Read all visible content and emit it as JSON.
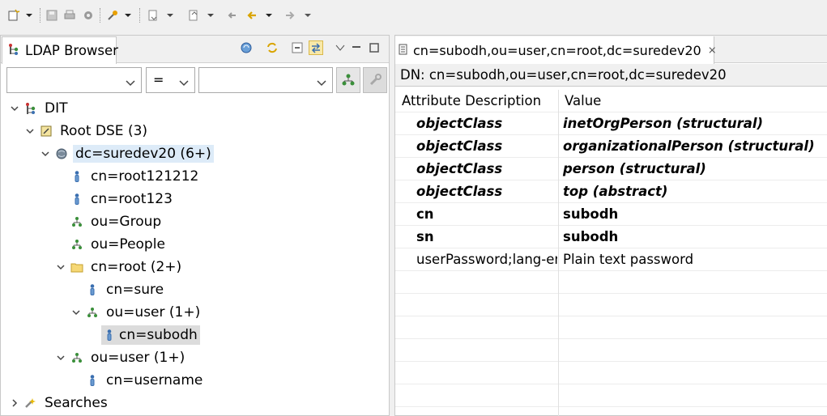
{
  "left_panel": {
    "tab_title": "LDAP Browser",
    "filter": {
      "attribute_value": "",
      "operator_value": "=",
      "value_value": ""
    },
    "tree": [
      {
        "label": "DIT"
      },
      {
        "label": "Root DSE (3)"
      },
      {
        "label": "dc=suredev20 (6+)"
      },
      {
        "label": "cn=root121212"
      },
      {
        "label": "cn=root123"
      },
      {
        "label": "ou=Group"
      },
      {
        "label": "ou=People"
      },
      {
        "label": "cn=root (2+)"
      },
      {
        "label": "cn=sure"
      },
      {
        "label": "ou=user (1+)"
      },
      {
        "label": "cn=subodh"
      },
      {
        "label": "ou=user (1+)"
      },
      {
        "label": "cn=username"
      },
      {
        "label": "Searches"
      }
    ]
  },
  "editor": {
    "tab_title": "cn=subodh,ou=user,cn=root,dc=suredev20",
    "close_glyph": "⨯",
    "dn_text": "DN: cn=subodh,ou=user,cn=root,dc=suredev20",
    "columns": [
      "Attribute Description",
      "Value"
    ],
    "rows": [
      {
        "attr": "objectClass",
        "value": "inetOrgPerson (structural)"
      },
      {
        "attr": "objectClass",
        "value": "organizationalPerson (structural)"
      },
      {
        "attr": "objectClass",
        "value": "person (structural)"
      },
      {
        "attr": "objectClass",
        "value": "top (abstract)"
      },
      {
        "attr": "cn",
        "value": "subodh"
      },
      {
        "attr": "sn",
        "value": "subodh"
      },
      {
        "attr": "userPassword;lang-en-",
        "value": "Plain text password"
      }
    ]
  },
  "icons": {
    "toolbar": [
      "new-icon",
      "save-icon",
      "print-icon",
      "settings-icon",
      "pin-icon",
      "next-annotation-icon",
      "prev-annotation-icon",
      "back-icon",
      "forward-icon"
    ],
    "tree": [
      "dit-icon",
      "root-dse-icon",
      "globe-icon",
      "person-icon",
      "group-icon",
      "folder-icon",
      "searches-icon"
    ]
  },
  "colors": {
    "selection": "#dcdcdc",
    "highlight": "#ddebf8",
    "tree_icon_blue": "#3a6fb0",
    "folder_yellow": "#e8c24a"
  }
}
